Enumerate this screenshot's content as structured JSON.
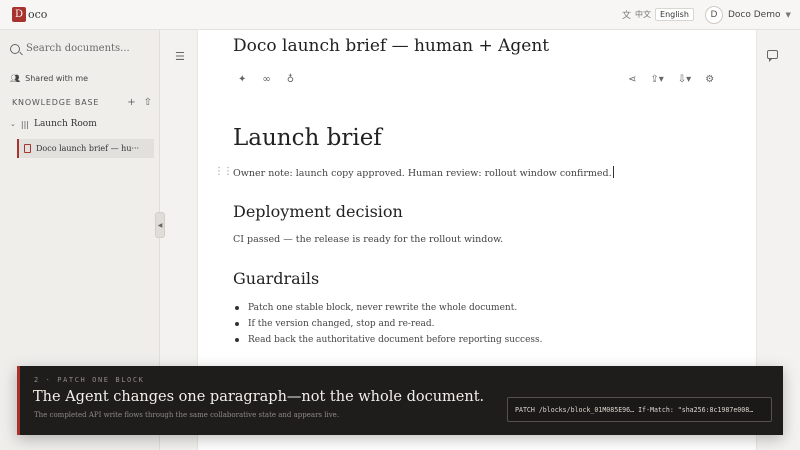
{
  "app": {
    "logo_letter": "D",
    "logo_text": "oco",
    "accent_color": "#a8322d"
  },
  "header": {
    "lang_icon": "translate-icon",
    "lang_zh": "中文",
    "lang_en": "English",
    "avatar_letter": "D",
    "user_name": "Doco Demo"
  },
  "sidebar": {
    "search_placeholder": "Search documents...",
    "shared_label": "Shared with me",
    "kb_title": "KNOWLEDGE BASE",
    "kb_add": "+",
    "kb_upload": "⇧",
    "room_label": "Launch Room",
    "doc_item_label": "Doco launch brief — hu···"
  },
  "document": {
    "title": "Doco launch brief — human + Agent",
    "h1": "Launch brief",
    "owner_note": "Owner note: launch copy approved. Human review: rollout window confirmed.",
    "h2_deploy": "Deployment decision",
    "ci_text": "CI passed — the release is ready for the rollout window.",
    "h2_guard": "Guardrails",
    "bullets": [
      "Patch one stable block, never rewrite the whole document.",
      "If the version changed, stop and re-read.",
      "Read back the authoritative document before reporting success."
    ]
  },
  "overlay": {
    "step": "2 · PATCH ONE BLOCK",
    "headline": "The Agent changes one paragraph—not the whole document.",
    "subline": "The completed API write flows through the same collaborative state and appears live.",
    "code": "PATCH /blocks/block_01M085E96… If-Match: \"sha256:8c1987e008…"
  }
}
